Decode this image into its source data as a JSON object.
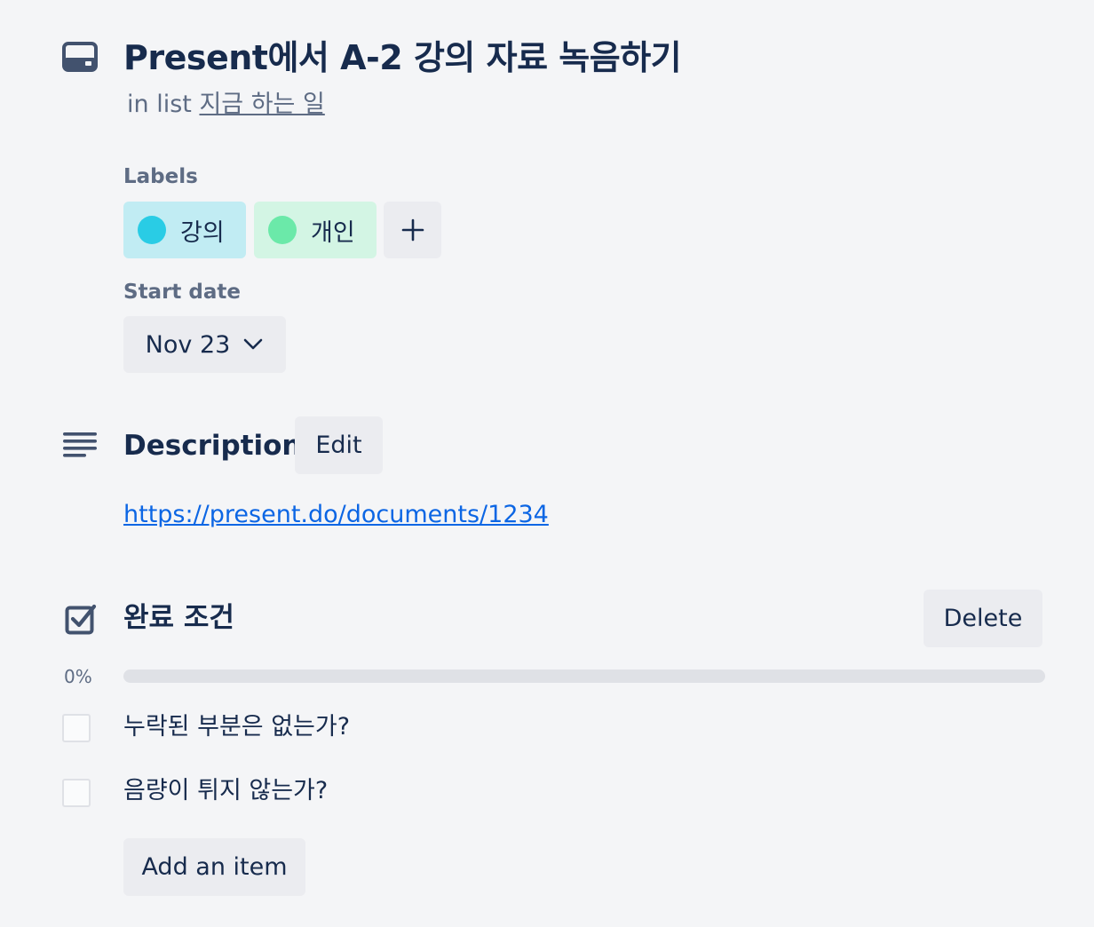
{
  "card": {
    "title": "Present에서 A-2 강의 자료 녹음하기",
    "in_list_prefix": "in list",
    "list_name": "지금 하는 일",
    "icon": "card-icon"
  },
  "labels": {
    "heading": "Labels",
    "items": [
      {
        "name": "강의",
        "bg": "#c1ecf3",
        "dot": "#29cce5"
      },
      {
        "name": "개인",
        "bg": "#d3f5e4",
        "dot": "#6be9a9"
      }
    ],
    "add_label": "+"
  },
  "start_date": {
    "heading": "Start date",
    "value": "Nov 23",
    "icon": "chevron-down-icon"
  },
  "description": {
    "heading": "Description",
    "edit_label": "Edit",
    "link": "https://present.do/documents/1234",
    "icon": "description-icon"
  },
  "checklist": {
    "title": "완료 조건",
    "delete_label": "Delete",
    "progress_text": "0%",
    "progress": 0,
    "items": [
      {
        "text": "누락된 부분은 없는가?",
        "checked": false
      },
      {
        "text": "음량이 튀지 않는가?",
        "checked": false
      }
    ],
    "add_item_label": "Add an item",
    "icon": "checklist-icon"
  }
}
